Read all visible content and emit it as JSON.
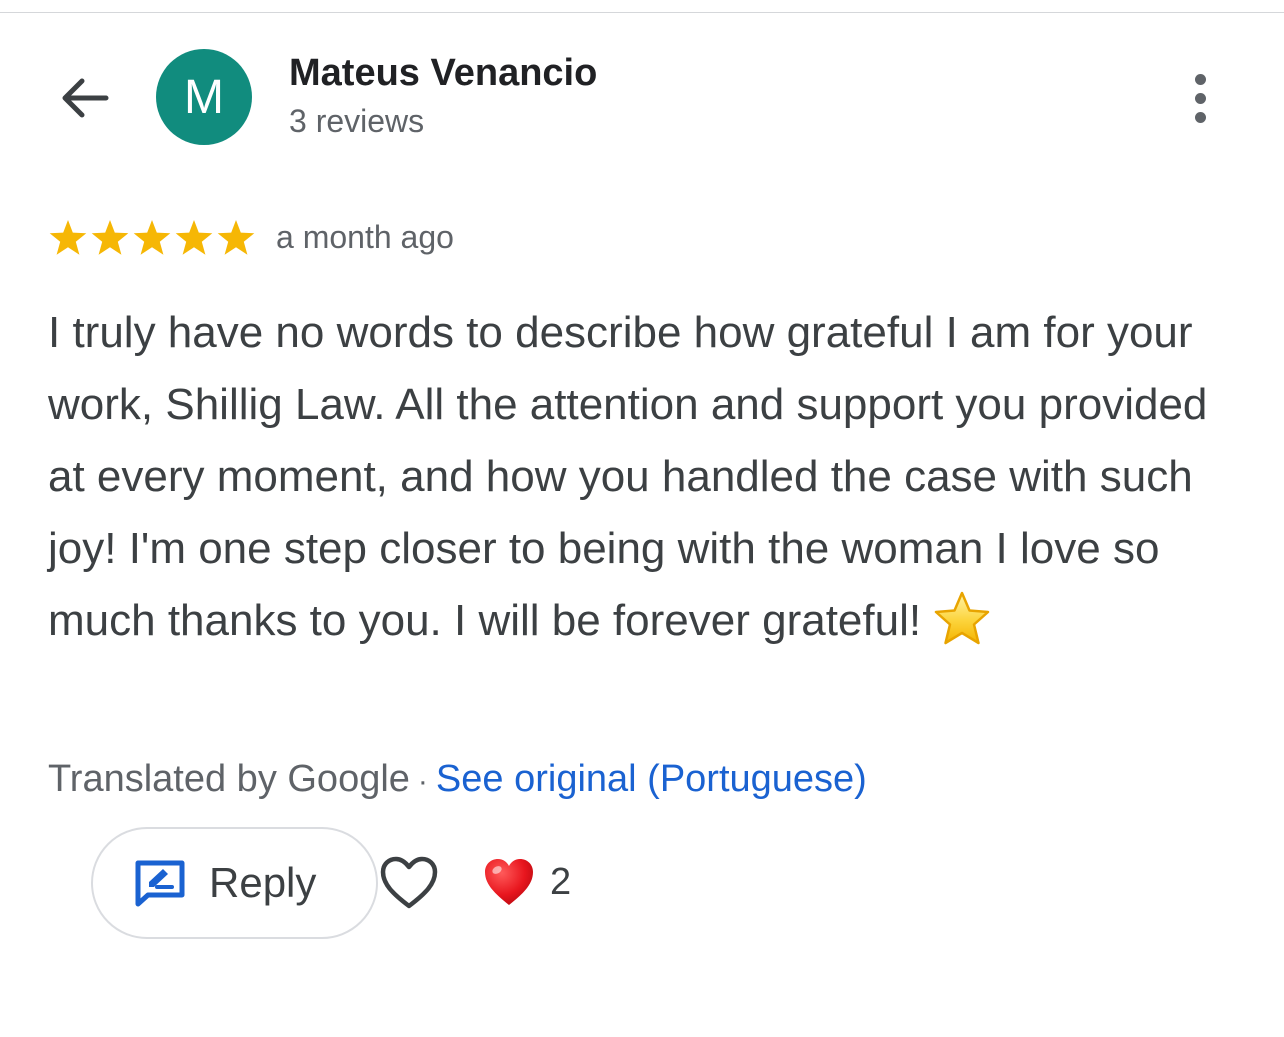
{
  "header": {
    "back_icon": "arrow-back-icon",
    "avatar_letter": "M",
    "avatar_color": "#118c7e",
    "author_name": "Mateus Venancio",
    "author_meta": "3 reviews",
    "more_icon": "more-vertical-icon"
  },
  "review": {
    "rating": 5,
    "rating_max": 5,
    "star_color": "#f6b705",
    "time": "a month ago",
    "text": "I truly have no words to describe how grateful I am for your work, Shillig Law. All the attention and support you provided at every moment, and how you handled the case with such joy! I'm one step closer to being with the woman I love so much thanks to you. I will be forever grateful!",
    "trailing_emoji_icon": "star-emoji-icon"
  },
  "translation": {
    "label": "Translated by Google",
    "separator": "·",
    "see_original": "See original (Portuguese)",
    "link_color": "#1a62d1"
  },
  "actions": {
    "reply_label": "Reply",
    "reply_icon": "reply-edit-icon",
    "like_icon": "heart-outline-icon",
    "reaction_icon": "red-heart-emoji-icon",
    "reaction_count": "2"
  }
}
